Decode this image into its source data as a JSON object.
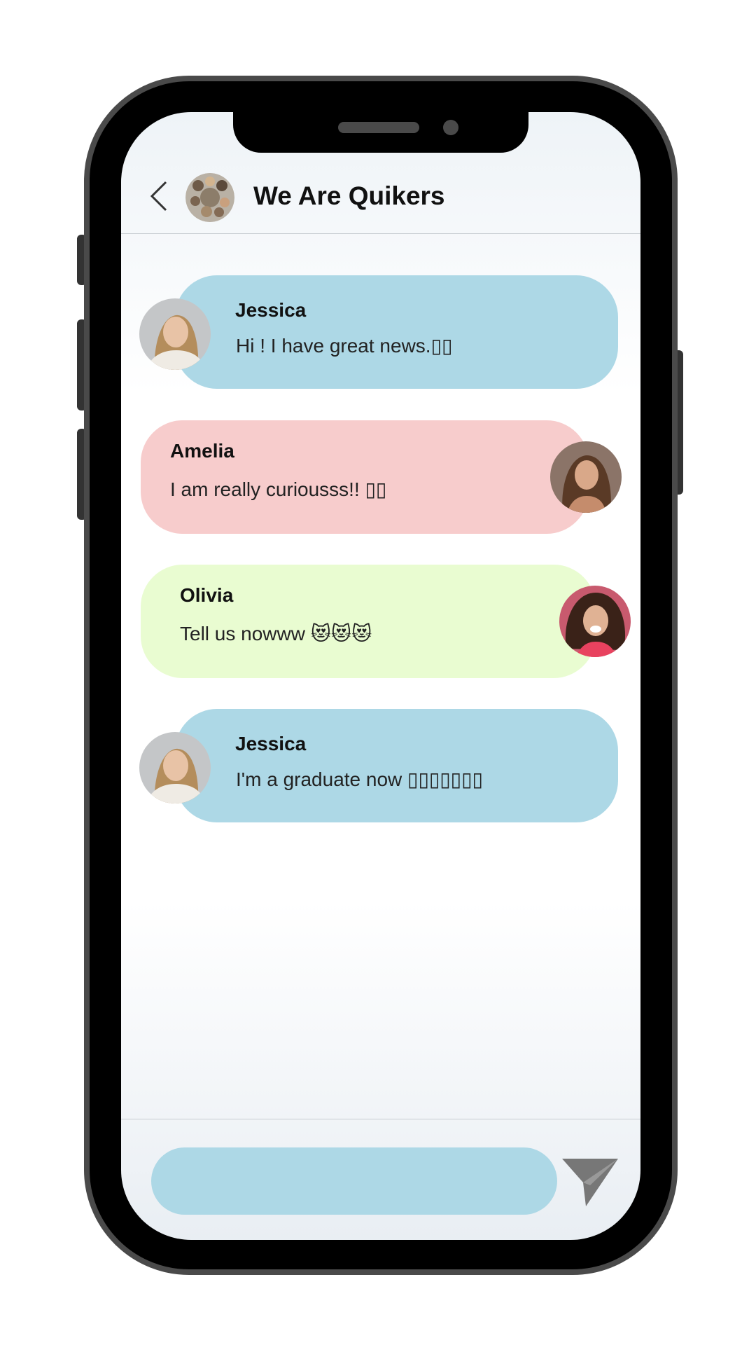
{
  "app": {
    "group_name": "We Are Quikers"
  },
  "header": {
    "back_icon": "chevron-left-icon",
    "avatar_icon": "group-photo-avatar"
  },
  "messages": [
    {
      "sender": "Jessica",
      "text": "Hi ! I have great news.▯▯",
      "side": "left",
      "color": "#add8e6"
    },
    {
      "sender": "Amelia",
      "text": "I am really curiousss!! ▯▯",
      "side": "right",
      "color": "#f7cccc"
    },
    {
      "sender": "Olivia",
      "text": "Tell us nowww 😻😻😻",
      "side": "right",
      "color": "#e9fcd1"
    },
    {
      "sender": "Jessica",
      "text": "I'm a graduate now ▯▯▯▯▯▯▯",
      "side": "left",
      "color": "#add8e6"
    }
  ],
  "composer": {
    "input_value": "",
    "send_icon": "send-icon"
  },
  "colors": {
    "accent_blue": "#add8e6",
    "pink": "#f7cccc",
    "green": "#e9fcd1",
    "frame": "#4a4a4a"
  }
}
